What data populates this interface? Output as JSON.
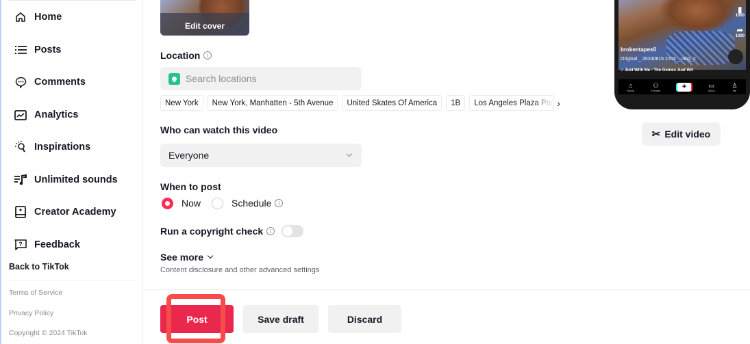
{
  "sidebar": {
    "items": [
      {
        "label": "Home",
        "icon": "home-icon"
      },
      {
        "label": "Posts",
        "icon": "list-icon"
      },
      {
        "label": "Comments",
        "icon": "comment-icon"
      },
      {
        "label": "Analytics",
        "icon": "analytics-icon"
      },
      {
        "label": "Inspirations",
        "icon": "lightbulb-icon"
      },
      {
        "label": "Unlimited sounds",
        "icon": "music-icon"
      },
      {
        "label": "Creator Academy",
        "icon": "academy-icon"
      },
      {
        "label": "Feedback",
        "icon": "feedback-icon"
      }
    ],
    "back_link": "Back to TikTok",
    "footer": {
      "terms": "Terms of Service",
      "privacy": "Privacy Policy",
      "copyright": "Copyright © 2024 TikTok"
    }
  },
  "cover": {
    "edit_label": "Edit cover"
  },
  "location": {
    "label": "Location",
    "placeholder": "Search locations",
    "value": "",
    "suggestions": [
      "New York",
      "New York, Manhatten - 5th Avenue",
      "United Skates Of America",
      "1B",
      "Los Angeles Plaza Park"
    ]
  },
  "visibility": {
    "label": "Who can watch this video",
    "selected": "Everyone"
  },
  "schedule": {
    "label": "When to post",
    "options": [
      {
        "label": "Now",
        "selected": true
      },
      {
        "label": "Schedule",
        "selected": false
      }
    ]
  },
  "copyright_check": {
    "label": "Run a copyright check",
    "enabled": false
  },
  "see_more": {
    "label": "See more",
    "subtitle": "Content disclosure and other advanced settings"
  },
  "actions": {
    "post": "Post",
    "save_draft": "Save draft",
    "discard": "Discard"
  },
  "preview": {
    "username": "brokentapes0",
    "original_sound": "Original _ 20240815 2203 _ mbg_2",
    "music": "Just With Me - The Genies   Just Wit",
    "save_count": "1000",
    "share_count": "1000",
    "nav": [
      "Home",
      "Friends",
      "+",
      "Inbox",
      "Me"
    ]
  },
  "edit_video": {
    "label": "Edit video"
  },
  "colors": {
    "accent": "#fe2c55",
    "post_button": "#ea284e",
    "highlight": "#f84b4b",
    "location_pin": "#25c28f"
  }
}
